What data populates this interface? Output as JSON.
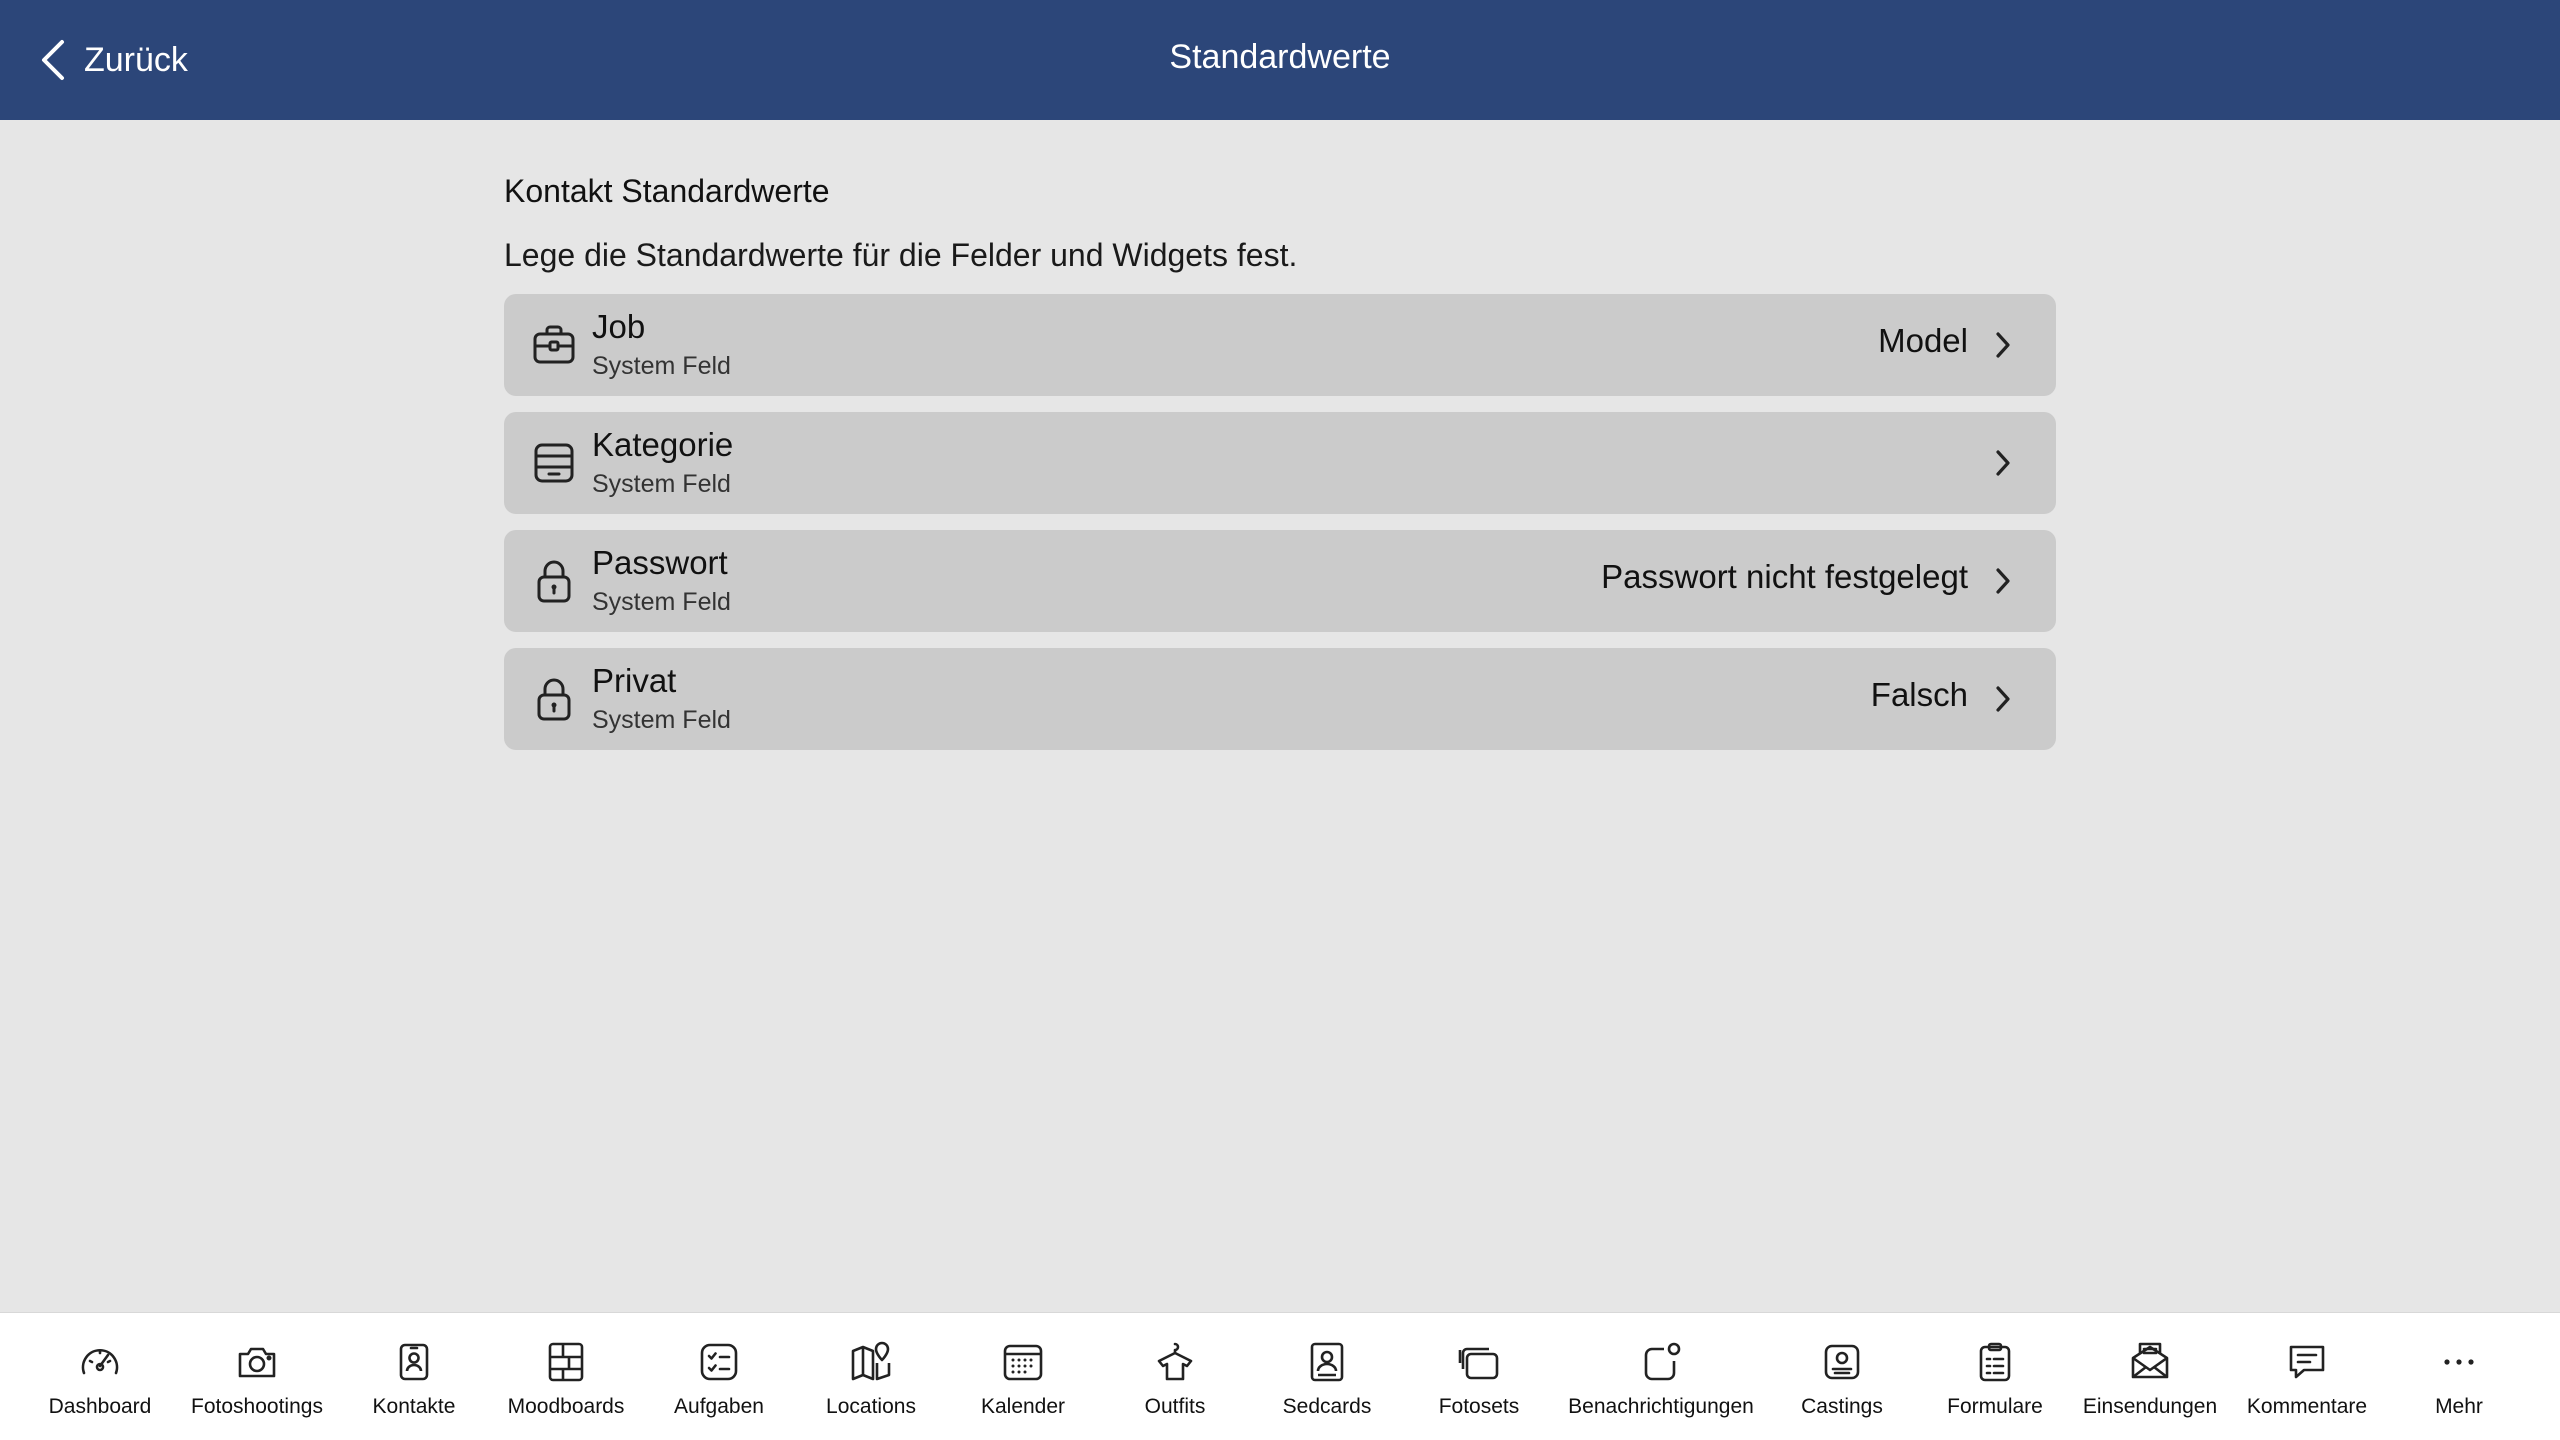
{
  "navbar": {
    "back_label": "Zurück",
    "title": "Standardwerte",
    "background": "#2c4679"
  },
  "section": {
    "title": "Kontakt Standardwerte",
    "description": "Lege die Standardwerte für die Felder und Widgets fest."
  },
  "rows": [
    {
      "title": "Job",
      "subtitle": "System Feld",
      "value": "Model",
      "icon": "briefcase-icon"
    },
    {
      "title": "Kategorie",
      "subtitle": "System Feld",
      "value": "",
      "icon": "archive-icon"
    },
    {
      "title": "Passwort",
      "subtitle": "System Feld",
      "value": "Passwort nicht festgelegt",
      "icon": "lock-icon"
    },
    {
      "title": "Privat",
      "subtitle": "System Feld",
      "value": "Falsch",
      "icon": "lock-icon"
    }
  ],
  "tabs": [
    {
      "label": "Dashboard",
      "icon": "gauge-icon"
    },
    {
      "label": "Fotoshootings",
      "icon": "camera-icon"
    },
    {
      "label": "Kontakte",
      "icon": "contact-icon"
    },
    {
      "label": "Moodboards",
      "icon": "moodboard-icon"
    },
    {
      "label": "Aufgaben",
      "icon": "checklist-icon"
    },
    {
      "label": "Locations",
      "icon": "map-icon"
    },
    {
      "label": "Kalender",
      "icon": "calendar-icon"
    },
    {
      "label": "Outfits",
      "icon": "shirt-icon"
    },
    {
      "label": "Sedcards",
      "icon": "sedcard-icon"
    },
    {
      "label": "Fotosets",
      "icon": "photosets-icon"
    },
    {
      "label": "Benachrichtigungen",
      "icon": "notification-icon"
    },
    {
      "label": "Castings",
      "icon": "casting-icon"
    },
    {
      "label": "Formulare",
      "icon": "clipboard-icon"
    },
    {
      "label": "Einsendungen",
      "icon": "envelope-icon"
    },
    {
      "label": "Kommentare",
      "icon": "comment-icon"
    },
    {
      "label": "Mehr",
      "icon": "more-icon"
    }
  ]
}
